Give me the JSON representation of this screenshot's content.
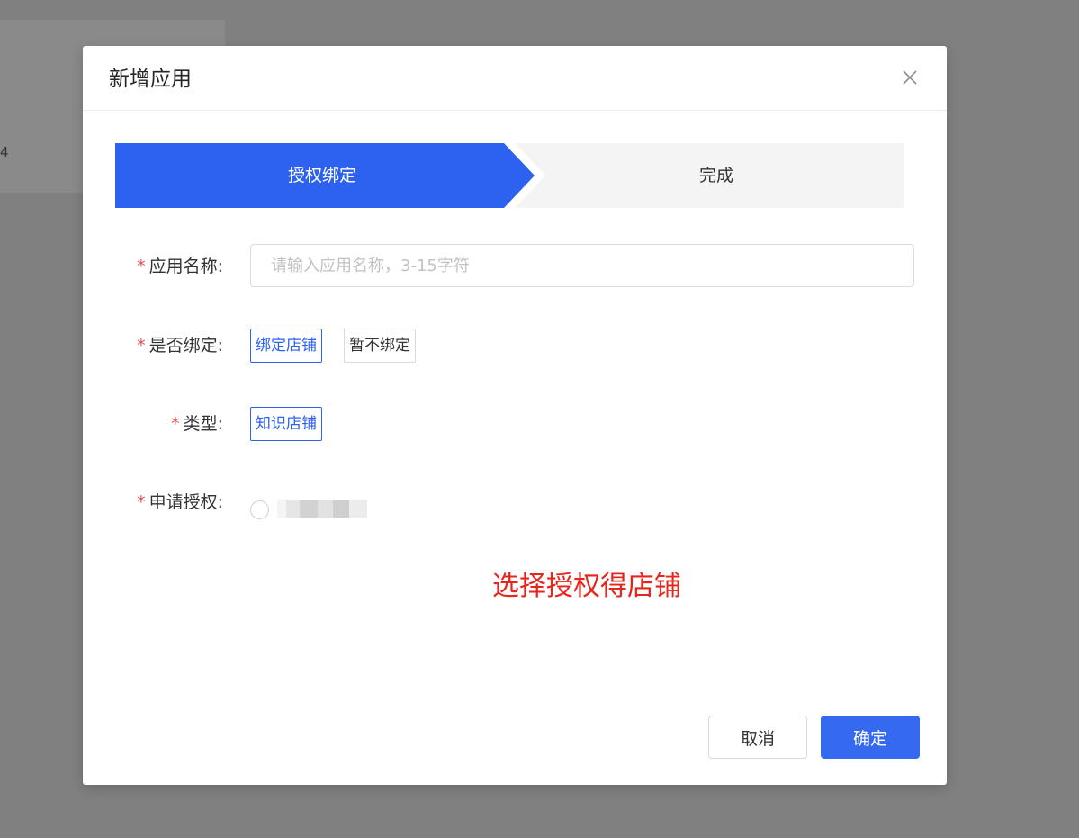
{
  "background": {
    "fragment_char": "4"
  },
  "modal": {
    "title": "新增应用",
    "close_icon": "close-icon"
  },
  "steps": [
    {
      "label": "授权绑定",
      "active": true,
      "color": "#2d62f0"
    },
    {
      "label": "完成",
      "active": false,
      "color": "#f4f4f4"
    }
  ],
  "form": {
    "app_name": {
      "label": "应用名称:",
      "placeholder": "请输入应用名称，3-15字符",
      "value": ""
    },
    "bind": {
      "label": "是否绑定:",
      "options": [
        "绑定店铺",
        "暂不绑定"
      ],
      "selected": "绑定店铺"
    },
    "type": {
      "label": "类型:",
      "options": [
        "知识店铺"
      ],
      "selected": "知识店铺"
    },
    "authorize": {
      "label": "申请授权:"
    },
    "required_mark": "*"
  },
  "annotation": "选择授权得店铺",
  "footer": {
    "cancel_label": "取消",
    "ok_label": "确定"
  },
  "colors": {
    "primary": "#3469f0",
    "required": "#e34d4d",
    "annotation": "#e8251d",
    "overlay": "#808080"
  }
}
